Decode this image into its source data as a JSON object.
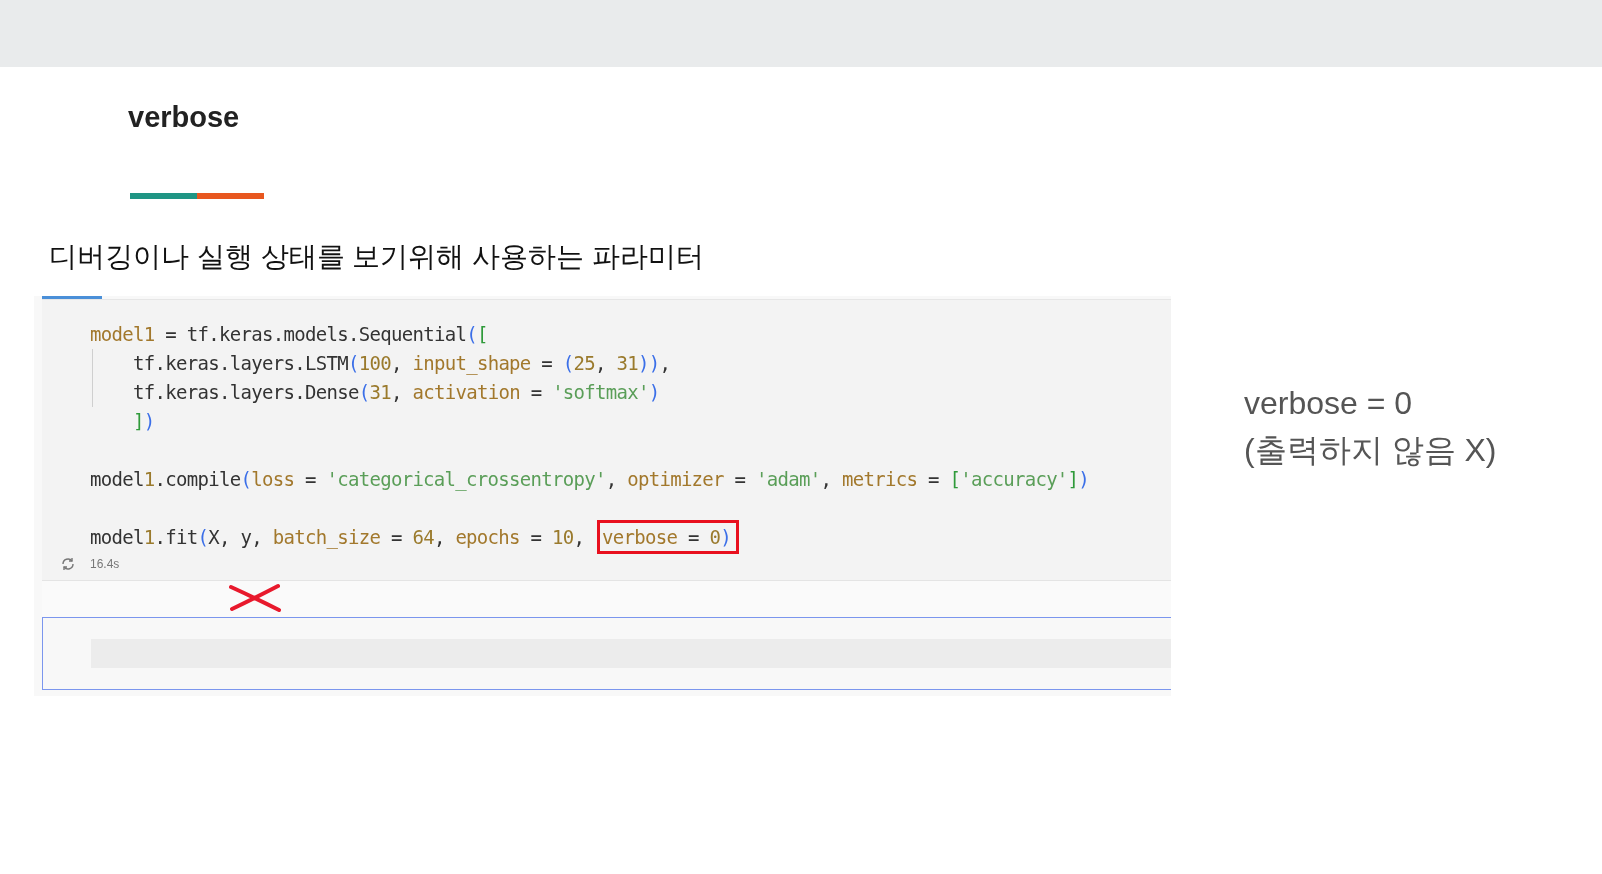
{
  "slide": {
    "title": "verbose",
    "subtitle": "디버깅이나 실행 상태를 보기위해 사용하는 파라미터"
  },
  "notebook": {
    "cell": {
      "blocks": [
        [
          {
            "text": "model1 = tf.keras.models.Sequential(["
          },
          {
            "text": "    tf.keras.layers.LSTM(100, input_shape = (25, 31)),"
          },
          {
            "text": "    tf.keras.layers.Dense(31, activation = 'softmax')"
          },
          {
            "text": "    ])"
          }
        ],
        [
          {
            "text": "model1.compile(loss = 'categorical_crossentropy', optimizer = 'adam', metrics = ['accuracy'])"
          }
        ],
        [
          {
            "text": "model1.fit(X, y, batch_size = 64, epochs = 10, ",
            "highlight": "verbose = 0)"
          }
        ]
      ],
      "duration": "16.4s"
    }
  },
  "note": {
    "lines": [
      "verbose = 0",
      "(출력하지 않음 X)"
    ]
  }
}
